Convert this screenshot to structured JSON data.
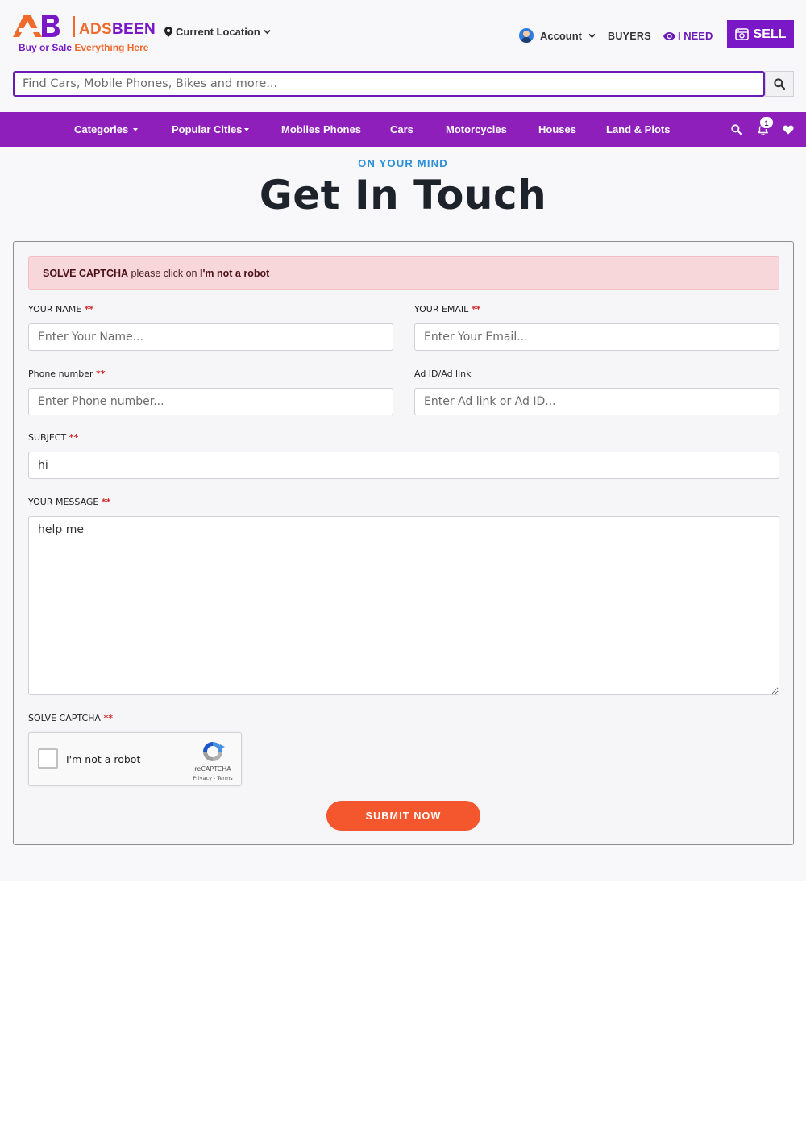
{
  "header": {
    "logo": {
      "name_part1": "ADS",
      "name_part2": "BEEN",
      "tagline_part1": "Buy or Sale",
      "tagline_part2": "Everything Here"
    },
    "location_label": "Current Location",
    "account_label": "Account",
    "buyers_label": "BUYERS",
    "ineed_label": "I NEED",
    "sell_label": "SELL",
    "search": {
      "placeholder": "Find Cars, Mobile Phones, Bikes and more..."
    }
  },
  "navbar": {
    "items": [
      {
        "label": "Categories",
        "dropdown": true
      },
      {
        "label": "Popular Cities",
        "dropdown": true
      },
      {
        "label": "Mobiles Phones"
      },
      {
        "label": "Cars"
      },
      {
        "label": "Motorcycles"
      },
      {
        "label": "Houses"
      },
      {
        "label": "Land & Plots"
      }
    ],
    "notification_count": "1"
  },
  "page": {
    "kicker": "ON YOUR MIND",
    "title": "Get In Touch"
  },
  "form": {
    "alert": {
      "strong": "SOLVE CAPTCHA",
      "text": " please click on ",
      "emphasis": "I'm not a robot"
    },
    "required_mark": "**",
    "name": {
      "label": "YOUR NAME",
      "placeholder": "Enter Your Name..."
    },
    "email": {
      "label": "YOUR EMAIL",
      "placeholder": "Enter Your Email..."
    },
    "phone": {
      "label": "Phone number",
      "placeholder": "Enter Phone number..."
    },
    "ad": {
      "label": "Ad ID/Ad link",
      "placeholder": "Enter Ad link or Ad ID..."
    },
    "subject": {
      "label": "SUBJECT",
      "value": "hi"
    },
    "message": {
      "label": "YOUR MESSAGE",
      "value": "help me"
    },
    "captcha": {
      "label": "SOLVE CAPTCHA",
      "checkbox_label": "I'm not a robot",
      "brand": "reCAPTCHA",
      "terms": "Privacy - Terms"
    },
    "submit_label": "SUBMIT NOW"
  },
  "colors": {
    "brand_purple": "#8e1fba",
    "brand_orange": "#ef6a2b",
    "submit": "#f4572e",
    "kicker": "#2a8fd6",
    "alert_bg": "#f8d7da"
  }
}
